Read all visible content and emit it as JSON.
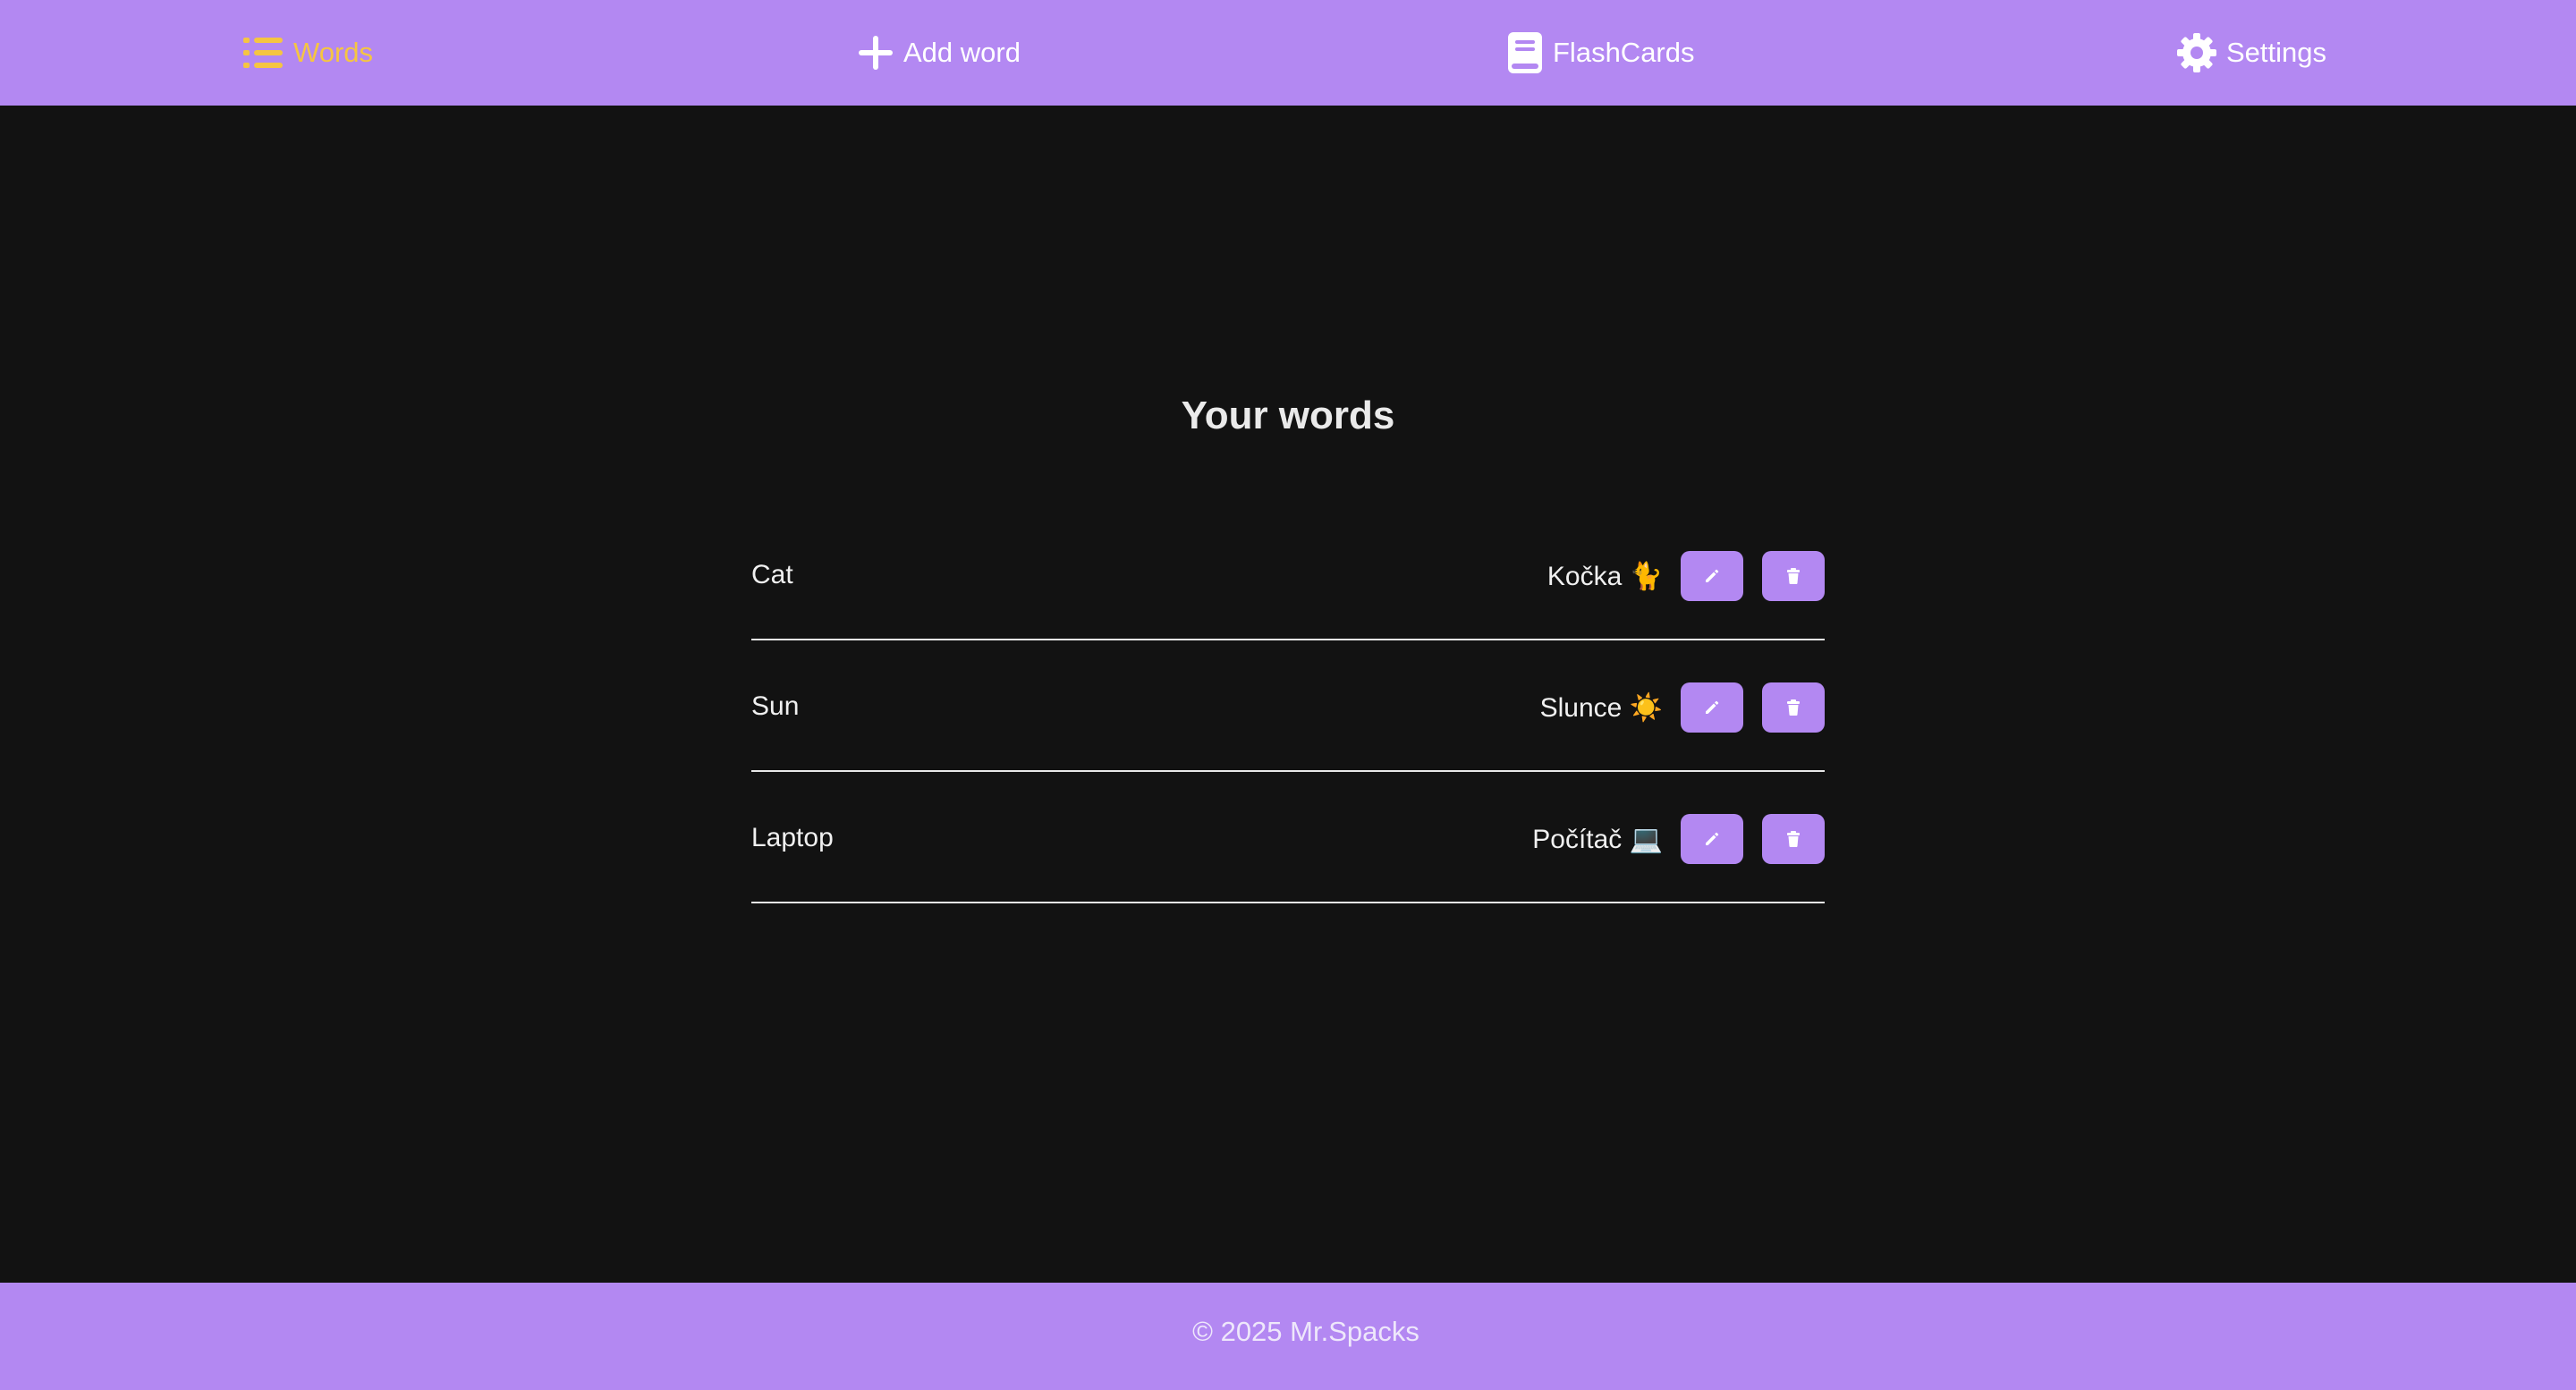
{
  "nav": {
    "items": [
      {
        "label": "Words",
        "icon": "list-icon",
        "active": true
      },
      {
        "label": "Add word",
        "icon": "plus-icon",
        "active": false
      },
      {
        "label": "FlashCards",
        "icon": "book-icon",
        "active": false
      },
      {
        "label": "Settings",
        "icon": "gear-icon",
        "active": false
      }
    ]
  },
  "main": {
    "title": "Your words",
    "words": [
      {
        "word": "Cat",
        "translation": "Kočka 🐈"
      },
      {
        "word": "Sun",
        "translation": "Slunce ☀️"
      },
      {
        "word": "Laptop",
        "translation": "Počítač 💻"
      }
    ],
    "row_actions": {
      "edit_icon": "pencil-icon",
      "delete_icon": "trash-icon"
    }
  },
  "footer": {
    "text": "© 2025 Mr.Spacks"
  },
  "colors": {
    "accent": "#b388f2",
    "active_nav": "#f5c542",
    "background": "#121212"
  }
}
